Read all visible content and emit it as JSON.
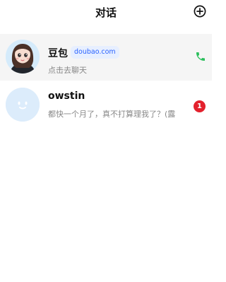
{
  "header": {
    "title": "对话",
    "add_icon": "plus-circle-icon"
  },
  "conversations": [
    {
      "name": "豆包",
      "tag": "doubao.com",
      "preview": "点击去聊天",
      "action_icon": "phone-icon",
      "accent_color": "#2bbf5c"
    },
    {
      "name": "owstin",
      "preview": "都快一个月了，真不打算理我了？(露",
      "unread_count": "1",
      "badge_color": "#e3212d"
    }
  ]
}
